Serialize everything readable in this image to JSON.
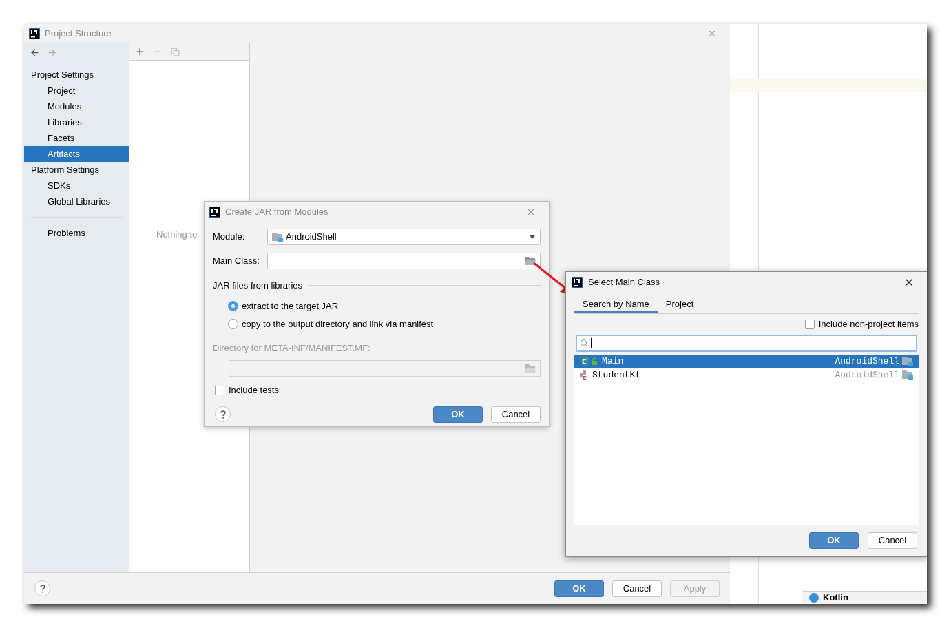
{
  "window": {
    "title": "Project Structure"
  },
  "sidebar": {
    "sections": [
      {
        "label": "Project Settings",
        "items": [
          {
            "label": "Project",
            "selected": false
          },
          {
            "label": "Modules",
            "selected": false
          },
          {
            "label": "Libraries",
            "selected": false
          },
          {
            "label": "Facets",
            "selected": false
          },
          {
            "label": "Artifacts",
            "selected": true
          }
        ]
      },
      {
        "label": "Platform Settings",
        "items": [
          {
            "label": "SDKs",
            "selected": false
          },
          {
            "label": "Global Libraries",
            "selected": false
          }
        ]
      }
    ],
    "problems": {
      "label": "Problems",
      "selected": false
    }
  },
  "empty_text": "Nothing to",
  "footer_buttons": [
    {
      "label": "OK",
      "primary": true,
      "disabled": false
    },
    {
      "label": "Cancel",
      "primary": false,
      "disabled": false
    },
    {
      "label": "Apply",
      "primary": false,
      "disabled": true
    }
  ],
  "jar_dialog": {
    "title": "Create JAR from Modules",
    "module_label": "Module:",
    "module_value": "AndroidShell",
    "main_class_label": "Main Class:",
    "section_title": "JAR files from libraries",
    "options": [
      {
        "label": "extract to the target JAR",
        "selected": true
      },
      {
        "label": "copy to the output directory and link via manifest",
        "selected": false
      }
    ],
    "manifest_label": "Directory for META-INF/MANIFEST.MF:",
    "include_tests": {
      "label": "Include tests",
      "checked": false
    },
    "buttons": [
      {
        "label": "OK",
        "primary": true,
        "disabled": false
      },
      {
        "label": "Cancel",
        "primary": false,
        "disabled": false
      }
    ]
  },
  "main_class_dialog": {
    "title": "Select Main Class",
    "tabs": [
      {
        "label": "Search by Name",
        "selected": true
      },
      {
        "label": "Project",
        "selected": false
      }
    ],
    "include_non_project": {
      "label": "Include non-project items",
      "checked": false
    },
    "results": [
      {
        "name": "Main",
        "module": "AndroidShell",
        "selected": true,
        "kind": "class"
      },
      {
        "name": "StudentKt",
        "module": "AndroidShell",
        "selected": false,
        "kind": "kotlin_file"
      }
    ],
    "buttons": [
      {
        "label": "OK",
        "primary": true,
        "disabled": false
      },
      {
        "label": "Cancel",
        "primary": false,
        "disabled": false
      }
    ]
  },
  "notification": {
    "title": "Kotlin"
  }
}
